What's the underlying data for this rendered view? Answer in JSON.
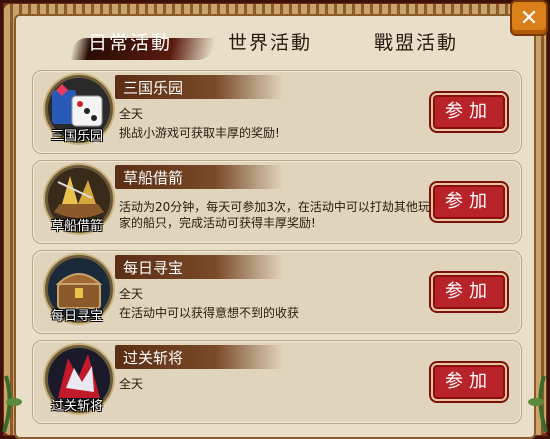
{
  "tabs": [
    {
      "label": "日常活動",
      "active": true
    },
    {
      "label": "世界活動",
      "active": false
    },
    {
      "label": "戰盟活動",
      "active": false
    }
  ],
  "close_glyph": "✕",
  "activities": [
    {
      "icon_name": "dice-icon",
      "icon_label": "三国乐园",
      "title": "三国乐园",
      "time": "全天",
      "desc": "挑战小游戏可获取丰厚的奖励!",
      "button": "参加"
    },
    {
      "icon_name": "straw-boat-icon",
      "icon_label": "草船借箭",
      "title": "草船借箭",
      "time": "",
      "desc": "活动为20分钟，每天可参加3次，在活动中可以打劫其他玩家的船只，完成活动可获得丰厚奖励!",
      "button": "参加"
    },
    {
      "icon_name": "treasure-chest-icon",
      "icon_label": "每日寻宝",
      "title": "每日寻宝",
      "time": "全天",
      "desc": "在活动中可以获得意想不到的收获",
      "button": "参加"
    },
    {
      "icon_name": "red-demon-icon",
      "icon_label": "过关斩将",
      "title": "过关斩将",
      "time": "全天",
      "desc": "",
      "button": "参加"
    }
  ],
  "colors": {
    "frame": "#7a2a1c",
    "panel": "#e9dfc9",
    "button": "#b8232a",
    "title_bar": "#5a2e14",
    "close": "#d9801a"
  }
}
